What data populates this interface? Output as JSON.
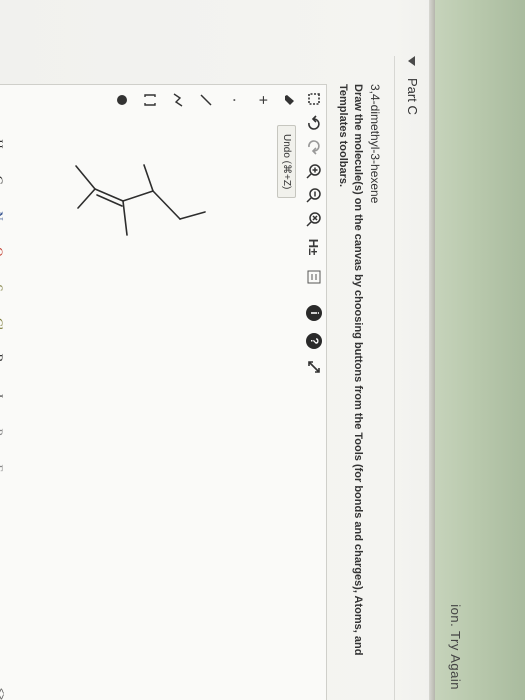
{
  "banner": {
    "text": "ion. Try Again"
  },
  "part": {
    "title": "Part C"
  },
  "question": {
    "molecule_name": "3,4-dimethyl-3-hexene",
    "instructions": "Draw the molecule(s) on the canvas by choosing buttons from the Tools (for bonds and charges), Atoms, and Templates toolbars."
  },
  "toolbar": {
    "tooltip": "Undo (⌘+Z)",
    "h_label": "H±",
    "info_label": "i",
    "help_label": "?"
  },
  "atoms": [
    "H",
    "C",
    "N",
    "O",
    "S",
    "Cl",
    "Br",
    "I",
    "P",
    "F"
  ],
  "icons": {
    "select": "select-tool-icon",
    "eraser": "eraser-icon",
    "undo": "undo-icon",
    "redo": "redo-icon",
    "zoom_in": "zoom-in-icon",
    "zoom_out": "zoom-out-icon",
    "reset": "reset-icon",
    "template": "template-icon",
    "info": "info-icon",
    "help": "help-icon",
    "expand": "expand-icon"
  },
  "colors": {
    "banner": "#b2c3a6",
    "panel": "#f3f3f0",
    "ink": "#333333"
  }
}
